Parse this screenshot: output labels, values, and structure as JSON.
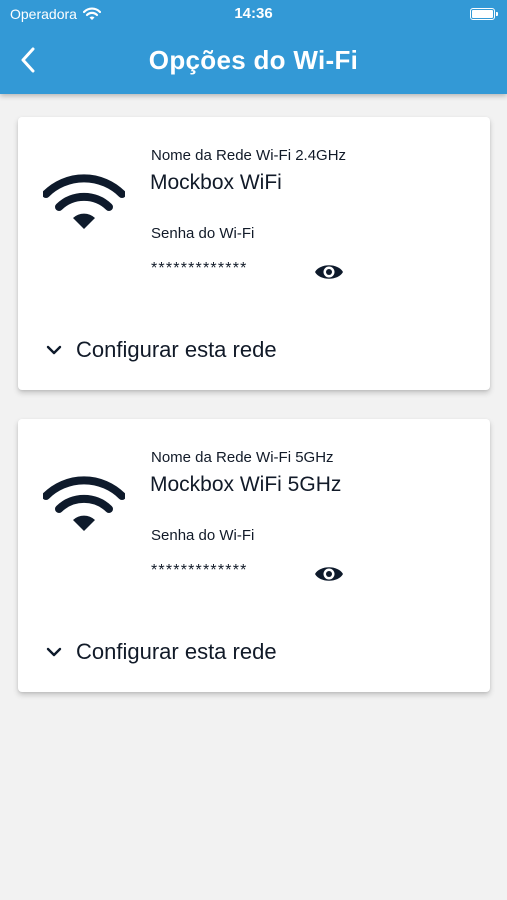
{
  "status_bar": {
    "carrier": "Operadora",
    "time": "14:36"
  },
  "nav": {
    "title": "Opções do Wi-Fi",
    "back_icon": "chevron-left-icon"
  },
  "networks": [
    {
      "label": "Nome da Rede Wi-Fi 2.4GHz",
      "name": "Mockbox WiFi",
      "password_label": "Senha do Wi-Fi",
      "password_masked": "*************",
      "configure_label": "Configurar esta rede"
    },
    {
      "label": "Nome da Rede Wi-Fi 5GHz",
      "name": "Mockbox WiFi 5GHz",
      "password_label": "Senha do Wi-Fi",
      "password_masked": "*************",
      "configure_label": "Configurar esta rede"
    }
  ],
  "colors": {
    "header_blue": "#3399d6",
    "text_dark": "#111a28",
    "background": "#f2f2f2",
    "card": "#ffffff"
  }
}
